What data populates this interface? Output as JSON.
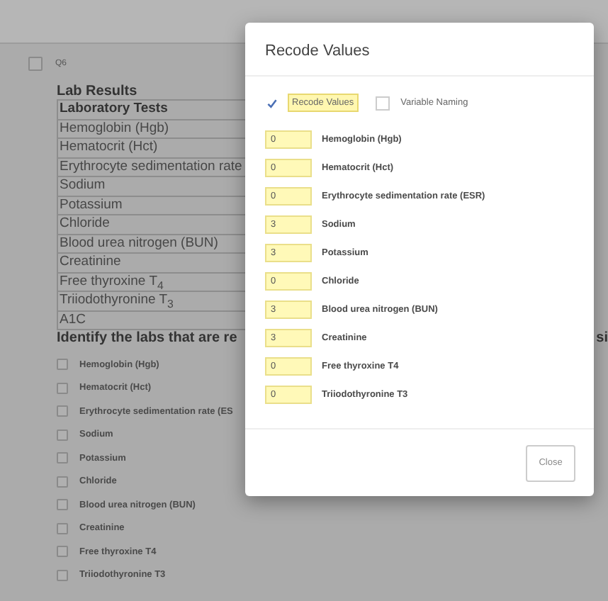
{
  "question": {
    "checked": false,
    "label": "Q6"
  },
  "title": "Lab Results",
  "table": {
    "header": "Laboratory Tests",
    "rows": [
      "Hemoglobin (Hgb)",
      "Hematocrit (Hct)",
      "Erythrocyte sedimentation rate",
      "Sodium",
      "Potassium",
      "Chloride",
      "Blood urea nitrogen (BUN)",
      "Creatinine",
      "Free thyroxine T$_{4}$",
      "Triiodothyronine T$_{3}$",
      "A1C"
    ]
  },
  "prompt": "Identify the labs that are re",
  "prompt_tail": "si",
  "options": [
    {
      "label": "Hemoglobin (Hgb)",
      "checked": false
    },
    {
      "label": "Hematocrit (Hct)",
      "checked": false
    },
    {
      "label": "Erythrocyte sedimentation rate (ES",
      "checked": false
    },
    {
      "label": "Sodium",
      "checked": false
    },
    {
      "label": "Potassium",
      "checked": false
    },
    {
      "label": "Chloride",
      "checked": false
    },
    {
      "label": "Blood urea nitrogen (BUN)",
      "checked": false
    },
    {
      "label": "Creatinine",
      "checked": false
    },
    {
      "label": "Free thyroxine T4",
      "checked": false
    },
    {
      "label": "Triiodothyronine T3",
      "checked": false
    }
  ],
  "dialog": {
    "title": "Recode Values",
    "toggles": [
      {
        "label": "Recode Values",
        "checked": true
      },
      {
        "label": "Variable Naming",
        "checked": false
      }
    ],
    "items": [
      {
        "value": "0",
        "label": "Hemoglobin (Hgb)"
      },
      {
        "value": "0",
        "label": "Hematocrit (Hct)"
      },
      {
        "value": "0",
        "label": "Erythrocyte sedimentation rate (ESR)"
      },
      {
        "value": "3",
        "label": "Sodium"
      },
      {
        "value": "3",
        "label": "Potassium"
      },
      {
        "value": "0",
        "label": "Chloride"
      },
      {
        "value": "3",
        "label": "Blood urea nitrogen (BUN)"
      },
      {
        "value": "3",
        "label": "Creatinine"
      },
      {
        "value": "0",
        "label": "Free thyroxine T4"
      },
      {
        "value": "0",
        "label": "Triiodothyronine T3"
      }
    ],
    "close": "Close"
  }
}
